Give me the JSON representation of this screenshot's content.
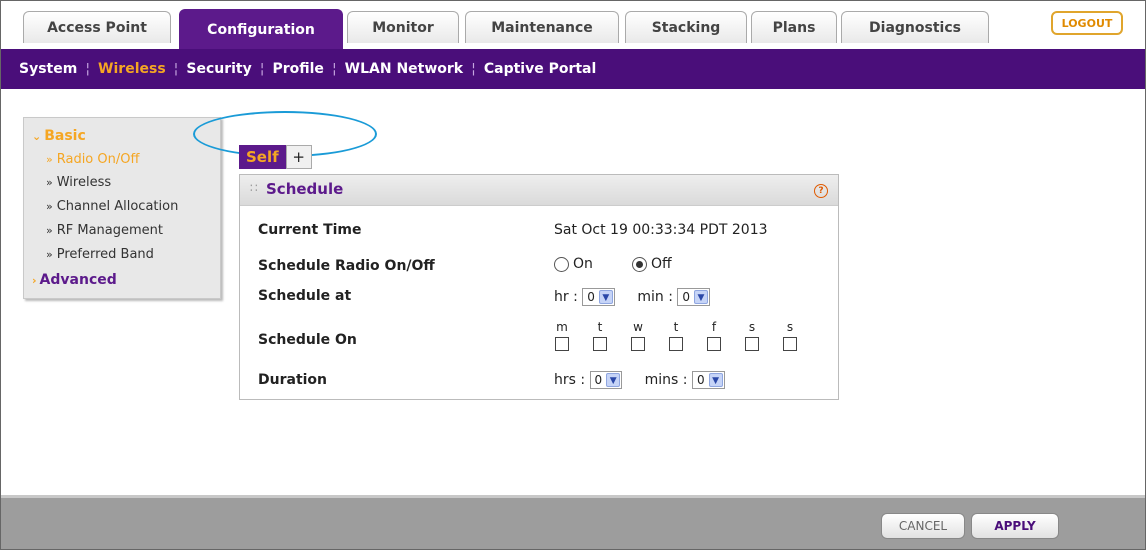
{
  "tabs": [
    {
      "label": "Access Point"
    },
    {
      "label": "Configuration"
    },
    {
      "label": "Monitor"
    },
    {
      "label": "Maintenance"
    },
    {
      "label": "Stacking"
    },
    {
      "label": "Plans"
    },
    {
      "label": "Diagnostics"
    }
  ],
  "logout_label": "LOGOUT",
  "subnav": [
    {
      "label": "System"
    },
    {
      "label": "Wireless"
    },
    {
      "label": "Security"
    },
    {
      "label": "Profile"
    },
    {
      "label": "WLAN Network"
    },
    {
      "label": "Captive Portal"
    }
  ],
  "sidebar": {
    "basic_label": "Basic",
    "items": [
      {
        "label": "Radio On/Off"
      },
      {
        "label": "Wireless"
      },
      {
        "label": "Channel Allocation"
      },
      {
        "label": "RF Management"
      },
      {
        "label": "Preferred Band"
      }
    ],
    "advanced_label": "Advanced"
  },
  "selftab": {
    "self_label": "Self",
    "plus_label": "+"
  },
  "schedule": {
    "title": "Schedule",
    "current_time_label": "Current Time",
    "current_time_value": "Sat Oct 19 00:33:34 PDT 2013",
    "radio_label": "Schedule Radio On/Off",
    "on_label": "On",
    "off_label": "Off",
    "selected_option": "Off",
    "schedule_at_label": "Schedule at",
    "hr_label": "hr :",
    "hr_value": "0",
    "min_label": "min :",
    "min_value": "0",
    "schedule_on_label": "Schedule On",
    "days": [
      "m",
      "t",
      "w",
      "t",
      "f",
      "s",
      "s"
    ],
    "duration_label": "Duration",
    "hrs_label": "hrs :",
    "hrs_value": "0",
    "mins_label": "mins :",
    "mins_value": "0"
  },
  "footer": {
    "cancel_label": "CANCEL",
    "apply_label": "APPLY"
  },
  "colors": {
    "brand_purple": "#4a0e7a",
    "accent_orange": "#f5a623",
    "highlight_circle": "#1a9bd7"
  }
}
